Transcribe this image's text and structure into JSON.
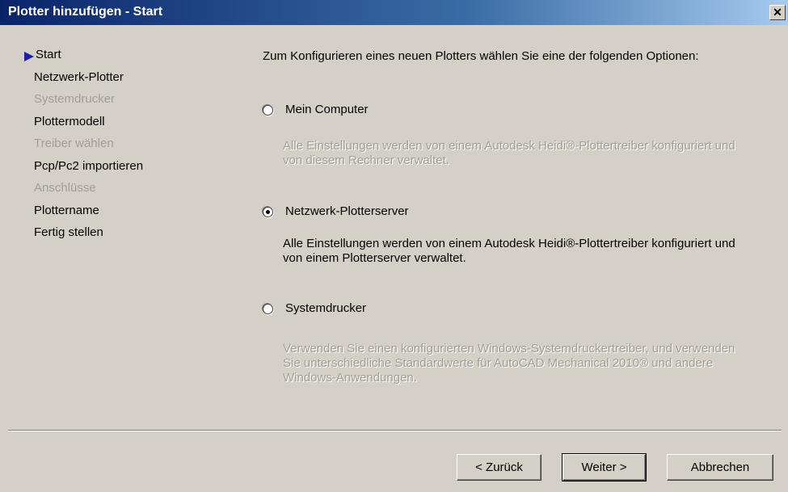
{
  "window": {
    "title": "Plotter hinzufügen - Start",
    "close_symbol": "✕"
  },
  "nav": {
    "items": [
      {
        "label": "Start",
        "state": "current"
      },
      {
        "label": "Netzwerk-Plotter",
        "state": "enabled"
      },
      {
        "label": "Systemdrucker",
        "state": "disabled"
      },
      {
        "label": "Plottermodell",
        "state": "enabled"
      },
      {
        "label": "Treiber wählen",
        "state": "disabled"
      },
      {
        "label": "Pcp/Pc2 importieren",
        "state": "enabled"
      },
      {
        "label": "Anschlüsse",
        "state": "disabled"
      },
      {
        "label": "Plottername",
        "state": "enabled"
      },
      {
        "label": "Fertig stellen",
        "state": "enabled"
      }
    ]
  },
  "main": {
    "intro": "Zum Konfigurieren eines neuen Plotters wählen Sie eine der folgenden Optionen:",
    "options": [
      {
        "label": "Mein Computer",
        "checked": false,
        "description": "Alle Einstellungen werden von einem Autodesk Heidi®-Plottertreiber konfiguriert und von diesem Rechner verwaltet.",
        "description_enabled": false
      },
      {
        "label": "Netzwerk-Plotterserver",
        "checked": true,
        "description": "Alle Einstellungen werden von einem Autodesk Heidi®-Plottertreiber konfiguriert und von einem Plotterserver verwaltet.",
        "description_enabled": true
      },
      {
        "label": "Systemdrucker",
        "checked": false,
        "description": "Verwenden Sie einen konfigurierten Windows-Systemdruckertreiber, und verwenden Sie unterschiedliche Standardwerte für AutoCAD Mechanical 2010® und andere Windows-Anwendungen.",
        "description_enabled": false
      }
    ]
  },
  "buttons": {
    "back": "< Zurück",
    "next": "Weiter >",
    "cancel": "Abbrechen"
  },
  "colors": {
    "title_start": "#0a246a",
    "title_end": "#a6caf0",
    "face": "#d4d0c8",
    "disabled_text": "#a19e96",
    "arrow": "#1f1fa6"
  }
}
